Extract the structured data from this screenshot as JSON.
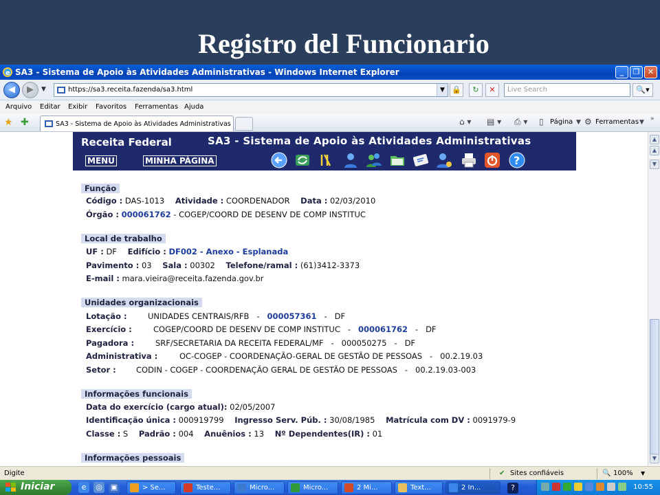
{
  "slide": {
    "title": "Registro del Funcionario"
  },
  "window": {
    "title": "SA3 - Sistema de Apoio às Atividades Administrativas - Windows Internet Explorer",
    "url": "https://sa3.receita.fazenda/sa3.html",
    "search_placeholder": "Live Search",
    "menu": [
      "Arquivo",
      "Editar",
      "Exibir",
      "Favoritos",
      "Ferramentas",
      "Ajuda"
    ],
    "tab_title": "SA3 - Sistema de Apoio às Atividades Administrativas",
    "commands": {
      "page": "Página",
      "tools": "Ferramentas"
    }
  },
  "sa3": {
    "brand": "Receita Federal",
    "system": "SA3 - Sistema de Apoio às Atividades Administrativas",
    "menu_link": "MENU",
    "home_link": "MINHA PÁGINA"
  },
  "funcao": {
    "heading": "Função",
    "codigo_label": "Código :",
    "codigo": "DAS-1013",
    "atividade_label": "Atividade :",
    "atividade": "COORDENADOR",
    "data_label": "Data :",
    "data": "02/03/2010",
    "orgao_label": "Órgão :",
    "orgao_code": "000061762",
    "orgao_desc": "- COGEP/COORD DE DESENV DE COMP INSTITUC"
  },
  "local": {
    "heading": "Local de trabalho",
    "uf_label": "UF :",
    "uf": "DF",
    "edificio_label": "Edifício :",
    "edificio": "DF002 - Anexo - Esplanada",
    "pavimento_label": "Pavimento :",
    "pavimento": "03",
    "sala_label": "Sala :",
    "sala": "00302",
    "telefone_label": "Telefone/ramal :",
    "telefone": "(61)3412-3373",
    "email_label": "E-mail :",
    "email": "mara.vieira@receita.fazenda.gov.br"
  },
  "unidades": {
    "heading": "Unidades organizacionais",
    "lotacao_label": "Lotação :",
    "lotacao": "UNIDADES CENTRAIS/RFB",
    "lotacao_code": "000057361",
    "lotacao_uf": "DF",
    "exercicio_label": "Exercício :",
    "exercicio": "COGEP/COORD DE DESENV DE COMP INSTITUC",
    "exercicio_code": "000061762",
    "exercicio_uf": "DF",
    "pagadora_label": "Pagadora :",
    "pagadora": "SRF/SECRETARIA DA RECEITA FEDERAL/MF",
    "pagadora_code": "000050275",
    "pagadora_uf": "DF",
    "administrativa_label": "Administrativa :",
    "administrativa": "OC-COGEP - COORDENAÇÃO-GERAL DE GESTÃO DE PESSOAS",
    "administrativa_code": "00.2.19.03",
    "setor_label": "Setor :",
    "setor": "CODIN - COGEP - COORDENAÇÃO GERAL DE GESTÃO DE PESSOAS",
    "setor_code": "00.2.19.03-003"
  },
  "funcionais": {
    "heading": "Informações funcionais",
    "data_exercicio_label": "Data do exercício (cargo atual):",
    "data_exercicio": "02/05/2007",
    "identificacao_label": "Identificação única :",
    "identificacao": "000919799",
    "ingresso_label": "Ingresso Serv. Púb. :",
    "ingresso": "30/08/1985",
    "matricula_label": "Matrícula com DV :",
    "matricula": "0091979-9",
    "classe_label": "Classe :",
    "classe": "S",
    "padrao_label": "Padrão :",
    "padrao": "004",
    "anuenios_label": "Anuênios :",
    "anuenios": "13",
    "dependentes_label": "Nº Dependentes(IR) :",
    "dependentes": "01"
  },
  "pessoais": {
    "heading": "Informações pessoais"
  },
  "status": {
    "left": "Digite",
    "zone": "Sites confiáveis",
    "zoom": "100%"
  },
  "taskbar": {
    "start": "Iniciar",
    "tasks": [
      "> Se...",
      "Teste...",
      "Micro...",
      "Micro...",
      "2 Mi...",
      "Text...",
      "2 In..."
    ],
    "clock": "10:55"
  }
}
